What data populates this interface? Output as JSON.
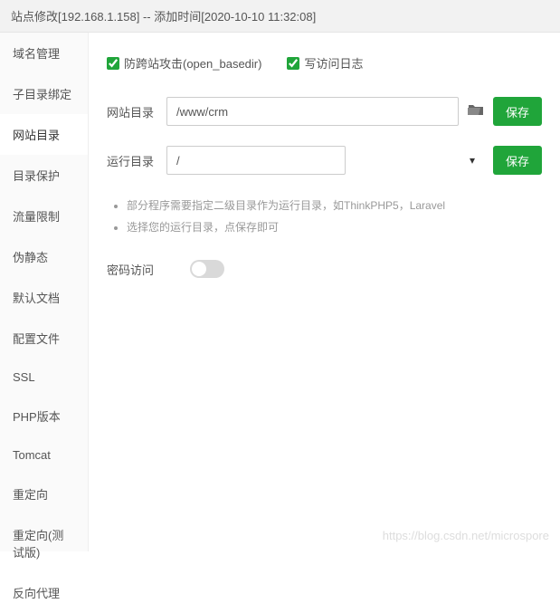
{
  "header": {
    "title": "站点修改[192.168.1.158] -- 添加时间[2020-10-10 11:32:08]"
  },
  "sidebar": {
    "items": [
      {
        "label": "域名管理"
      },
      {
        "label": "子目录绑定"
      },
      {
        "label": "网站目录",
        "active": true
      },
      {
        "label": "目录保护"
      },
      {
        "label": "流量限制"
      },
      {
        "label": "伪静态"
      },
      {
        "label": "默认文档"
      },
      {
        "label": "配置文件"
      },
      {
        "label": "SSL"
      },
      {
        "label": "PHP版本"
      },
      {
        "label": "Tomcat"
      },
      {
        "label": "重定向"
      },
      {
        "label": "重定向(测试版)"
      },
      {
        "label": "反向代理"
      }
    ]
  },
  "main": {
    "checkboxes": {
      "open_basedir_label": "防跨站攻击(open_basedir)",
      "access_log_label": "写访问日志"
    },
    "site_dir": {
      "label": "网站目录",
      "value": "/www/crm",
      "save_label": "保存"
    },
    "run_dir": {
      "label": "运行目录",
      "value": "/",
      "save_label": "保存"
    },
    "tips": {
      "line1": "部分程序需要指定二级目录作为运行目录，如ThinkPHP5，Laravel",
      "line2": "选择您的运行目录，点保存即可"
    },
    "password_access": {
      "label": "密码访问"
    }
  },
  "watermark": "https://blog.csdn.net/microspore"
}
